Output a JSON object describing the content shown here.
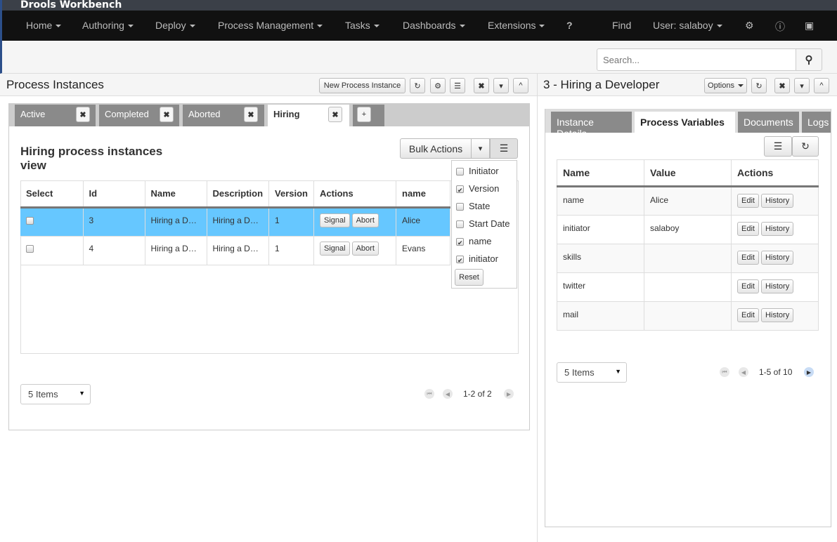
{
  "app": {
    "title": "Drools Workbench"
  },
  "nav": {
    "items": [
      {
        "label": "Home"
      },
      {
        "label": "Authoring"
      },
      {
        "label": "Deploy"
      },
      {
        "label": "Process Management"
      },
      {
        "label": "Tasks"
      },
      {
        "label": "Dashboards"
      },
      {
        "label": "Extensions"
      }
    ],
    "find": "Find",
    "user": "User: salaboy"
  },
  "search": {
    "placeholder": "Search..."
  },
  "left": {
    "title": "Process Instances",
    "new_instance": "New Process Instance",
    "tabs": [
      {
        "label": "Active"
      },
      {
        "label": "Completed"
      },
      {
        "label": "Aborted"
      },
      {
        "label": "Hiring"
      }
    ],
    "add_tab": "+",
    "close": "✖",
    "heading": "Hiring process instances view",
    "bulk_actions": "Bulk Actions",
    "columns": [
      "Select",
      "Id",
      "Name",
      "Description",
      "Version",
      "Actions",
      "name"
    ],
    "rows": [
      {
        "id": "3",
        "name": "Hiring a D…",
        "description": "Hiring a D…",
        "version": "1",
        "signal": "Signal",
        "abort": "Abort",
        "var_name": "Alice",
        "selected": true
      },
      {
        "id": "4",
        "name": "Hiring a D…",
        "description": "Hiring a D…",
        "version": "1",
        "signal": "Signal",
        "abort": "Abort",
        "var_name": "Evans",
        "selected": false
      }
    ],
    "column_menu": [
      {
        "label": "Initiator",
        "checked": false
      },
      {
        "label": "Version",
        "checked": true
      },
      {
        "label": "State",
        "checked": false
      },
      {
        "label": "Start Date",
        "checked": false
      },
      {
        "label": "name",
        "checked": true
      },
      {
        "label": "initiator",
        "checked": true
      }
    ],
    "reset": "Reset",
    "page_size": "5 Items",
    "page_info": "1-2 of 2"
  },
  "right": {
    "title": "3 - Hiring a Developer",
    "options": "Options",
    "tabs": [
      {
        "label": "Instance Details"
      },
      {
        "label": "Process Variables"
      },
      {
        "label": "Documents"
      },
      {
        "label": "Logs"
      }
    ],
    "columns": [
      "Name",
      "Value",
      "Actions"
    ],
    "rows": [
      {
        "name": "name",
        "value": "Alice"
      },
      {
        "name": "initiator",
        "value": "salaboy"
      },
      {
        "name": "skills",
        "value": ""
      },
      {
        "name": "twitter",
        "value": ""
      },
      {
        "name": "mail",
        "value": ""
      }
    ],
    "edit": "Edit",
    "history": "History",
    "page_size": "5 Items",
    "page_info": "1-5 of 10"
  }
}
